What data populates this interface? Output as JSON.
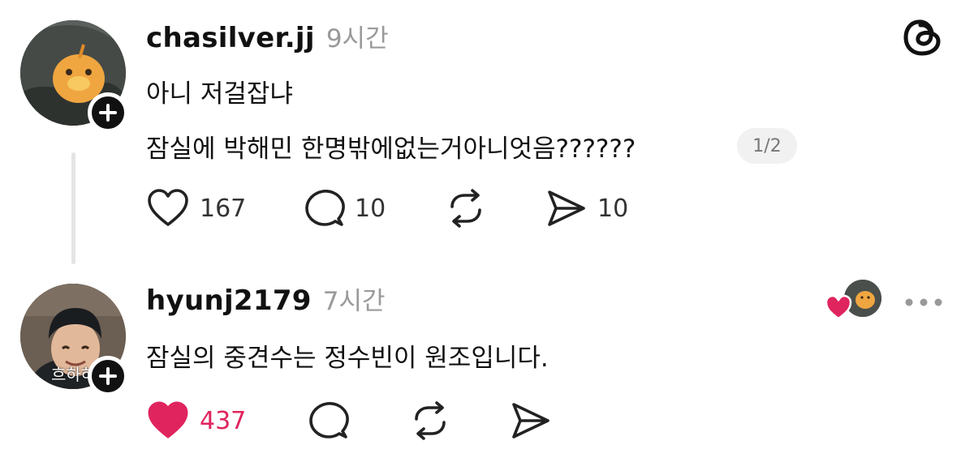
{
  "posts": [
    {
      "username": "chasilver.jj",
      "time": "9시간",
      "lines": [
        "아니 저걸잡냐",
        "잠실에 박해민 한명밖에없는거아니엇음??????"
      ],
      "page_indicator": "1/2",
      "actions": {
        "likes": "167",
        "replies": "10",
        "shares": "10"
      },
      "liked": false
    },
    {
      "username": "hyunj2179",
      "time": "7시간",
      "lines": [
        "잠실의 중견수는  정수빈이 원조입니다."
      ],
      "avatar_caption": "흐하하",
      "actions": {
        "likes": "437"
      },
      "liked": true
    }
  ],
  "colors": {
    "like_red": "#e0245e",
    "muted": "#9a9a9a"
  },
  "icons": [
    "threads-logo-icon",
    "plus-icon",
    "heart-icon",
    "comment-icon",
    "repost-icon",
    "share-icon",
    "more-icon"
  ]
}
